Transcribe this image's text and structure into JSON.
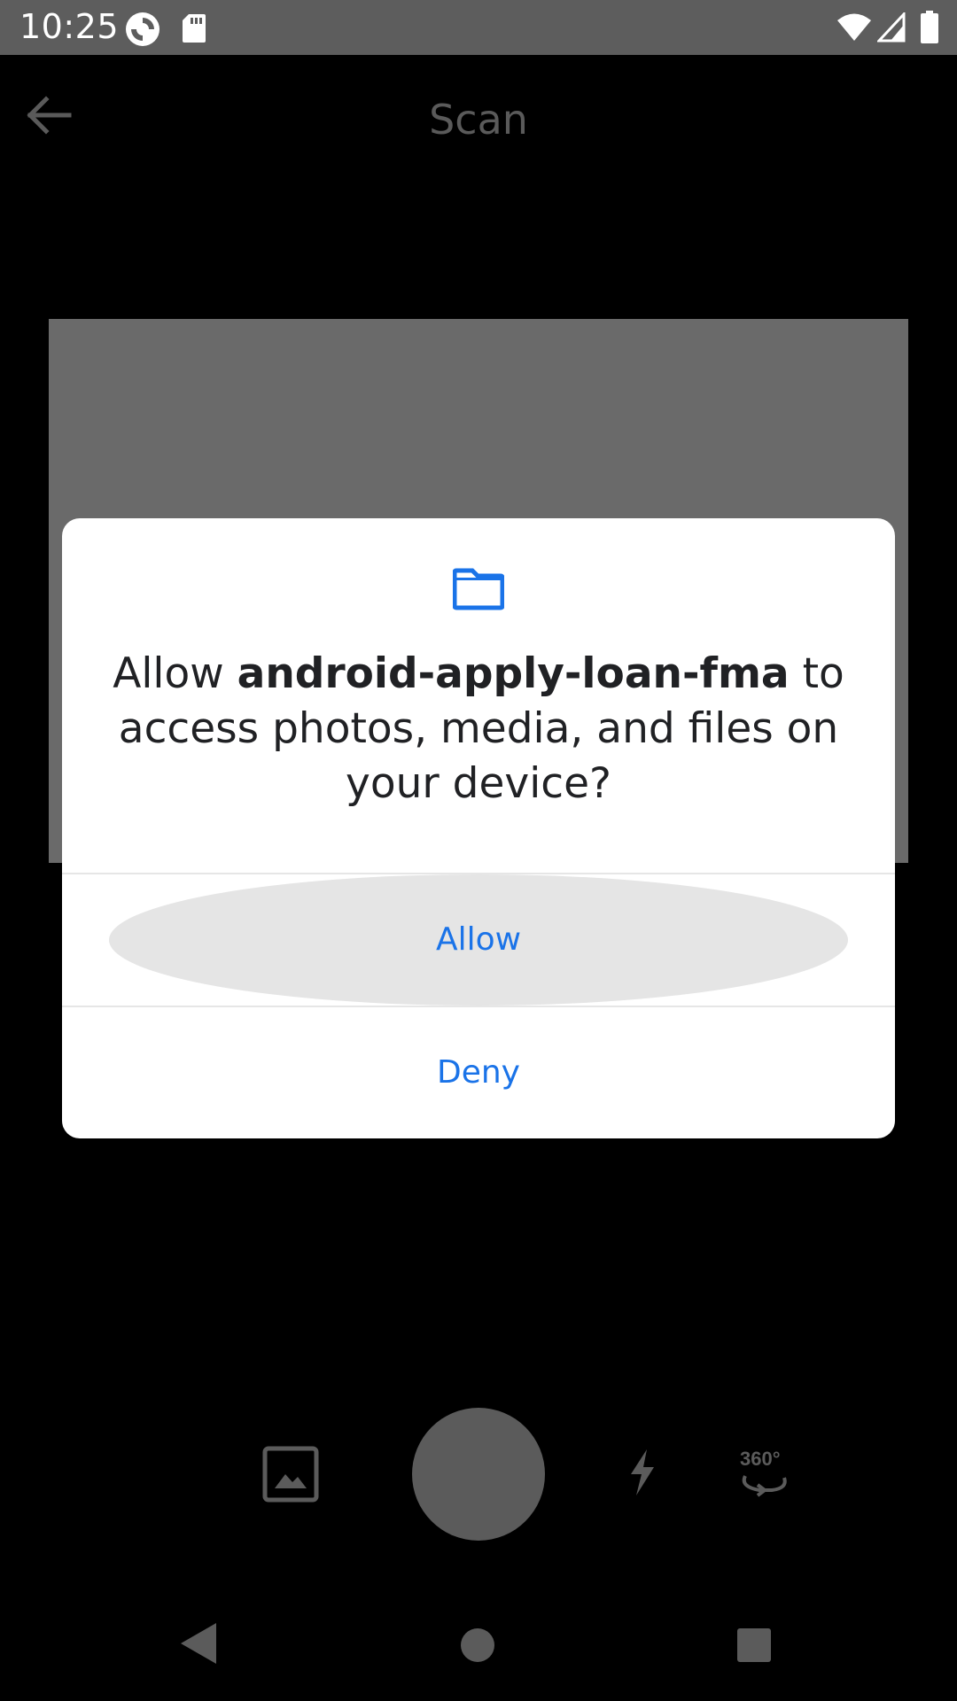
{
  "status_bar": {
    "time": "10:25",
    "icons": [
      "sync-icon",
      "sd-card-icon",
      "wifi-icon",
      "signal-icon",
      "battery-icon"
    ]
  },
  "app_bar": {
    "title": "Scan",
    "back_icon": "arrow-left-icon"
  },
  "controls": {
    "gallery_icon": "image-icon",
    "shutter_icon": "shutter-button",
    "flash_icon": "flash-icon",
    "rotate_icon": "360-rotate-icon",
    "rotate_label": "360°"
  },
  "dialog": {
    "icon": "folder-icon",
    "message_prefix": "Allow ",
    "app_name": "android-apply-loan-fma",
    "message_suffix": " to access photos, media, and files on your device?",
    "allow_label": "Allow",
    "deny_label": "Deny",
    "accent_color": "#1a73e8"
  },
  "nav_bar": {
    "back_icon": "nav-back-icon",
    "home_icon": "nav-home-icon",
    "recents_icon": "nav-recents-icon"
  }
}
